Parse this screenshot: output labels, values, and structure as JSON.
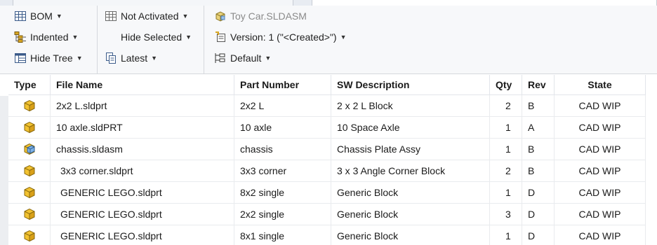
{
  "toolbar": {
    "bom_label": "BOM",
    "indented_label": "Indented",
    "hide_tree_label": "Hide Tree",
    "not_activated_label": "Not Activated",
    "hide_selected_label": "Hide Selected",
    "latest_label": "Latest",
    "file_label": "Toy Car.SLDASM",
    "version_label": "Version: 1 (\"<Created>\")",
    "default_label": "Default"
  },
  "columns": {
    "type": "Type",
    "file_name": "File Name",
    "part_number": "Part Number",
    "sw_description": "SW Description",
    "qty": "Qty",
    "rev": "Rev",
    "state": "State"
  },
  "rows": [
    {
      "icon": "part-icon",
      "file": "2x2 L.sldprt",
      "part": "2x2 L",
      "desc": "2 x 2 L Block",
      "qty": "2",
      "rev": "B",
      "state": "CAD WIP"
    },
    {
      "icon": "part-icon",
      "file": "10 axle.sldPRT",
      "part": "10 axle",
      "desc": "10 Space Axle",
      "qty": "1",
      "rev": "A",
      "state": "CAD WIP"
    },
    {
      "icon": "assembly-icon",
      "file": "chassis.sldasm",
      "part": "chassis",
      "desc": "Chassis Plate Assy",
      "qty": "1",
      "rev": "B",
      "state": "CAD WIP"
    },
    {
      "icon": "part-icon",
      "file": "3x3 corner.sldprt",
      "part": "3x3 corner",
      "desc": "3 x 3 Angle Corner Block",
      "qty": "2",
      "rev": "B",
      "state": "CAD WIP"
    },
    {
      "icon": "part-icon",
      "file": "GENERIC LEGO.sldprt",
      "part": "8x2 single",
      "desc": "Generic Block",
      "qty": "1",
      "rev": "D",
      "state": "CAD WIP"
    },
    {
      "icon": "part-icon",
      "file": "GENERIC LEGO.sldprt",
      "part": "2x2 single",
      "desc": "Generic Block",
      "qty": "3",
      "rev": "D",
      "state": "CAD WIP"
    },
    {
      "icon": "part-icon",
      "file": "GENERIC LEGO.sldprt",
      "part": "8x1 single",
      "desc": "Generic Block",
      "qty": "1",
      "rev": "D",
      "state": "CAD WIP"
    }
  ],
  "colors": {
    "part_icon": "#f2c230",
    "assembly_icon": "#7fb2e5",
    "toolbar_bg": "#f7f8fa"
  }
}
